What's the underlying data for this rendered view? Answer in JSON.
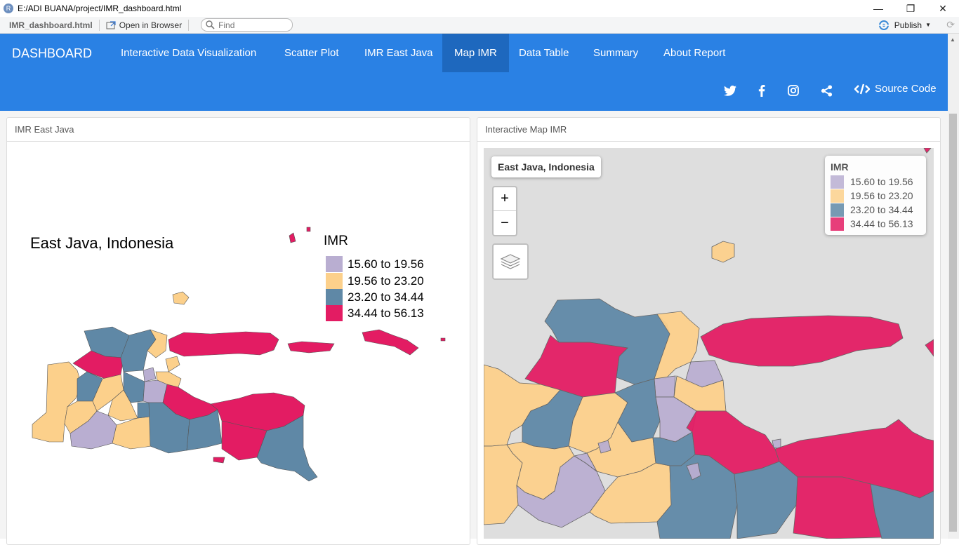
{
  "window": {
    "title": "E:/ADI BUANA/project/IMR_dashboard.html",
    "app_icon": "R"
  },
  "toolbar": {
    "filename": "IMR_dashboard.html",
    "open_browser": "Open in Browser",
    "find_placeholder": "Find",
    "publish": "Publish"
  },
  "navbar": {
    "brand": "DASHBOARD",
    "items": [
      {
        "label": "Interactive Data Visualization",
        "active": false
      },
      {
        "label": "Scatter Plot",
        "active": false
      },
      {
        "label": "IMR East Java",
        "active": false
      },
      {
        "label": "Map IMR",
        "active": true
      },
      {
        "label": "Data Table",
        "active": false
      },
      {
        "label": "Summary",
        "active": false
      },
      {
        "label": "About Report",
        "active": false
      }
    ],
    "social": [
      "twitter-icon",
      "facebook-icon",
      "instagram-icon",
      "share-icon"
    ],
    "source_code": "Source Code"
  },
  "colors": {
    "navbar": "#2a81e4",
    "navbar_active": "#1e68be",
    "imr_1": "#b9aed1",
    "imr_2": "#fcd08b",
    "imr_3": "#5f88a6",
    "imr_4": "#e31c63"
  },
  "panels": {
    "left": {
      "header": "IMR East Java",
      "map_title": "East Java, Indonesia",
      "legend_title": "IMR",
      "legend": [
        "15.60 to 19.56",
        "19.56 to 23.20",
        "23.20 to 34.44",
        "34.44 to 56.13"
      ]
    },
    "right": {
      "header": "Interactive Map IMR",
      "map_title": "East Java, Indonesia",
      "zoom_in": "+",
      "zoom_out": "−",
      "legend_title": "IMR",
      "legend": [
        "15.60 to 19.56",
        "19.56 to 23.20",
        "23.20 to 34.44",
        "34.44 to 56.13"
      ]
    }
  }
}
